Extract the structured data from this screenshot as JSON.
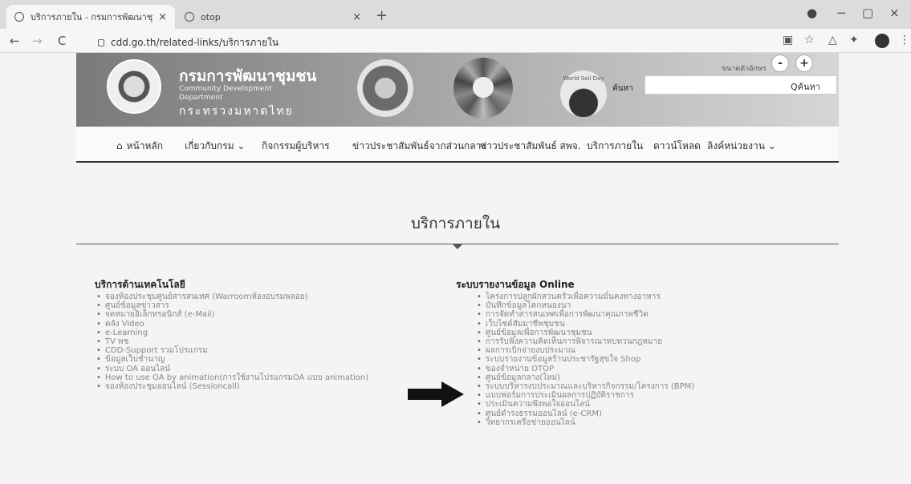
{
  "browser": {
    "tabs": [
      {
        "title": "บริการภายใน - กรมการพัฒนาชุมชน",
        "close": "×"
      },
      {
        "title": "otop",
        "close": "×"
      }
    ],
    "new_tab": "+",
    "window_controls": {
      "minimize": "−",
      "restore": "▢",
      "close": "×"
    },
    "nav": {
      "back": "←",
      "forward": "→",
      "reload": "C"
    },
    "url": "cdd.go.th/related-links/บริการภายใน"
  },
  "header": {
    "department_th": "กรมการพัฒนาชุมชน",
    "department_en": "Community Development Department",
    "ministry": "กระทรวงมหาดไทย",
    "world_soil_day": "World Soil Day",
    "search_label": "ค้นหา",
    "search_button": "Qค้นหา",
    "font_size_label": "ขนาดตัวอักษร",
    "font_decrease": "-",
    "font_increase": "+"
  },
  "nav_menu": {
    "items": [
      {
        "label": "หน้าหลัก",
        "icon": "home-icon"
      },
      {
        "label": "เกี่ยวกับกรม ⌄"
      },
      {
        "label": "กิจกรรมผู้บริหาร"
      },
      {
        "label": "ข่าวประชาสัมพันธ์จากส่วนกลาง"
      },
      {
        "label": "ข่าวประชาสัมพันธ์ สพจ."
      },
      {
        "label": "บริการภายใน"
      },
      {
        "label": "ดาวน์โหลด"
      },
      {
        "label": "ลิงค์หน่วยงาน ⌄"
      }
    ]
  },
  "main": {
    "page_title": "บริการภายใน",
    "left_column": {
      "heading": "บริการด้านเทคโนโลยี",
      "links": [
        "จองห้องประชุมศูนย์สารสนเทศ (Warroomห้องอบรมพลอย)",
        "ศูนย์ข้อมูลข่าวสาร",
        "จดหมายอิเล็กทรอนิกส์ (e-Mail)",
        "คลัง Video",
        "e-Learning",
        "TV พช",
        "CDD-Support รวมโปรแกรม",
        "ข้อมูลเว็บชำนาญ",
        "ระบบ OA ออนไลน์",
        "How to use OA by animation(การใช้งานโปรแกรมOA แบบ animation)",
        "จองห้องประชุมออนไลน์ (Sessioncall)"
      ]
    },
    "right_column": {
      "heading": "ระบบรายงานข้อมูล Online",
      "links": [
        "โครงการปลูกผักสวนครัวเพื่อความมั่นคงทางอาหาร",
        "บันทึกข้อมูลโคกหนองนา",
        "การจัดทำสารสนเทศเพื่อการพัฒนาคุณภาพชีวิต",
        "เว็บไซต์สัมมาชีพชุมชน",
        "ศูนย์ข้อมูลเพื่อการพัฒนาชุมชน",
        "การรับฟังความคิดเห็นการพิจารณาทบทวนกฎหมาย",
        "ผลการเบิกจ่ายงบประมาณ",
        "ระบบรายงานข้อมูลร้านประชารัฐสุขใจ Shop",
        "ของจำหน่าย OTOP",
        "ศูนย์ข้อมูลกลาง(ใหม่)",
        "ระบบบริหารงบประมาณและบริหารกิจกรรม/โครงการ (BPM)",
        "แบบฟอร์มการประเมินผลการปฏิบัติราชการ",
        "ประเมินความพึงพอใจออนไลน์",
        "ศูนย์ดำรงธรรมออนไลน์ (e-CRM)",
        "วิทยากรเครือข่ายออนไลน์"
      ]
    }
  }
}
